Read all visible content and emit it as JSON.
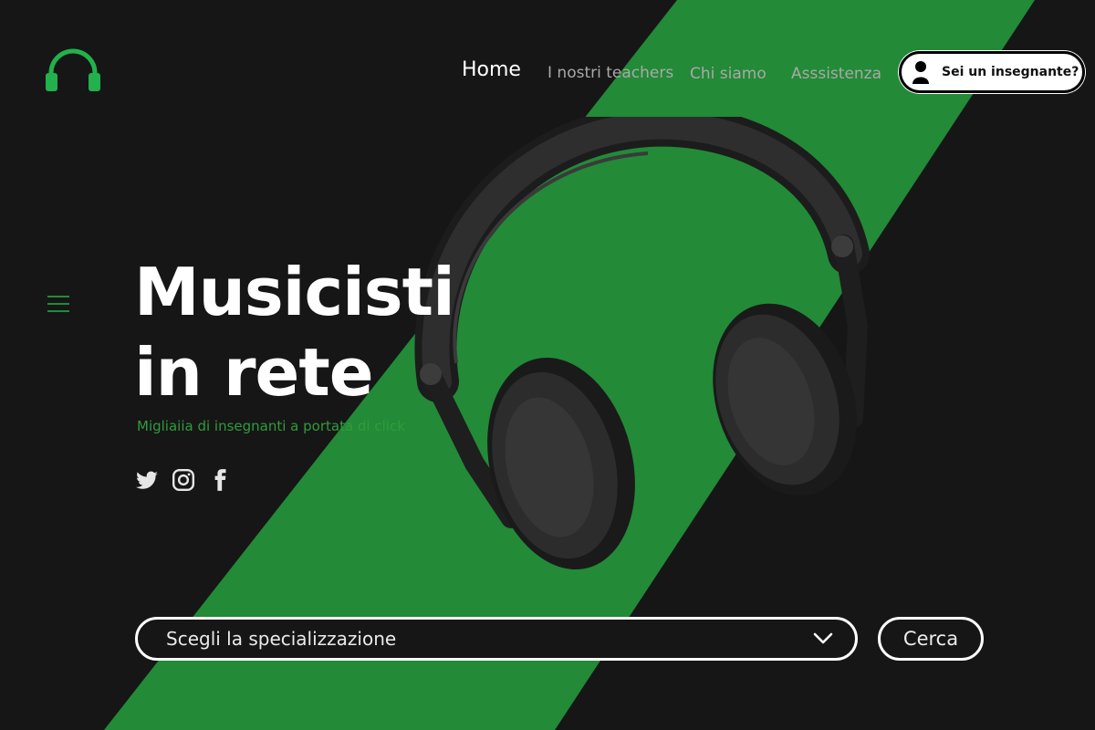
{
  "logo": {
    "icon": "headphones-icon"
  },
  "nav": {
    "items": [
      {
        "label": "Home",
        "active": true
      },
      {
        "label": "I nostri teachers",
        "active": false
      },
      {
        "label": "Chi siamo",
        "active": false
      },
      {
        "label": "Asssistenza",
        "active": false
      }
    ]
  },
  "teacher_button": {
    "label": "Sei un insegnante?",
    "icon": "user-icon"
  },
  "menu": {
    "icon": "hamburger-menu-icon"
  },
  "hero": {
    "title_line1": "Musicisti",
    "title_line2": "in rete",
    "subtitle": "Migliaiia di insegnanti a portata di click",
    "image_icon": "headphones-photo"
  },
  "social": {
    "icons": [
      "twitter-icon",
      "instagram-icon",
      "facebook-icon"
    ]
  },
  "search": {
    "select_value": "Scegli la specializzazione",
    "button_label": "Cerca"
  },
  "colors": {
    "background": "#161616",
    "accent_green": "#238a38",
    "logo_green": "#22b14c",
    "text_white": "#ffffff"
  }
}
